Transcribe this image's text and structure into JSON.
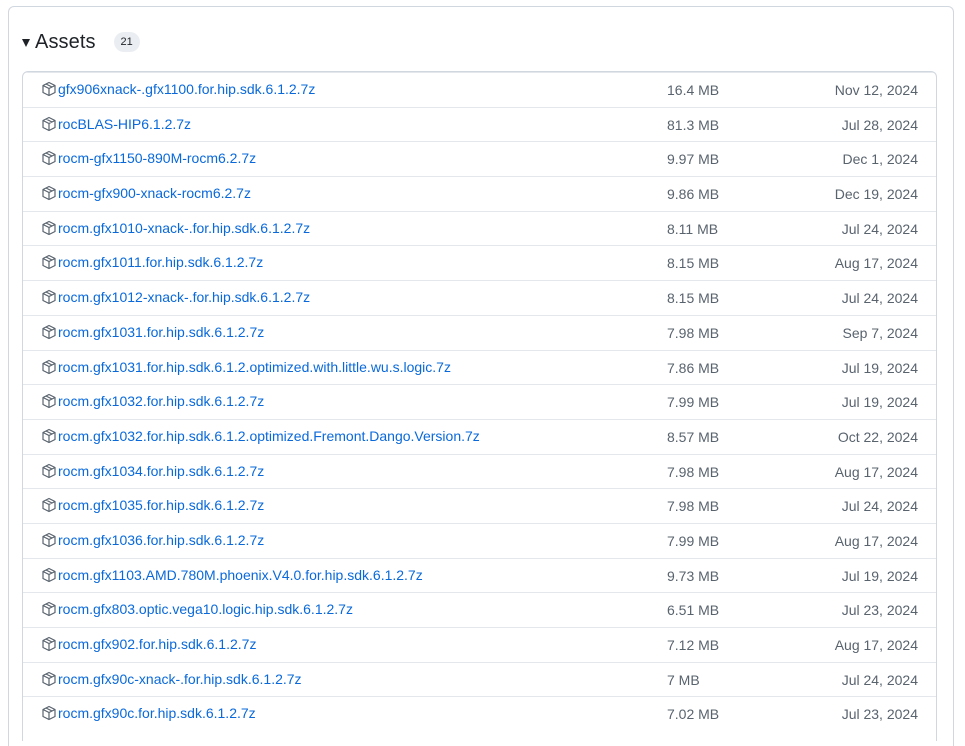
{
  "assets": {
    "title": "Assets",
    "count": "21",
    "items": [
      {
        "name": "gfx906xnack-.gfx1100.for.hip.sdk.6.1.2.7z",
        "size": "16.4 MB",
        "date": "Nov 12, 2024"
      },
      {
        "name": "rocBLAS-HIP6.1.2.7z",
        "size": "81.3 MB",
        "date": "Jul 28, 2024"
      },
      {
        "name": "rocm-gfx1150-890M-rocm6.2.7z",
        "size": "9.97 MB",
        "date": "Dec 1, 2024"
      },
      {
        "name": "rocm-gfx900-xnack-rocm6.2.7z",
        "size": "9.86 MB",
        "date": "Dec 19, 2024"
      },
      {
        "name": "rocm.gfx1010-xnack-.for.hip.sdk.6.1.2.7z",
        "size": "8.11 MB",
        "date": "Jul 24, 2024"
      },
      {
        "name": "rocm.gfx1011.for.hip.sdk.6.1.2.7z",
        "size": "8.15 MB",
        "date": "Aug 17, 2024"
      },
      {
        "name": "rocm.gfx1012-xnack-.for.hip.sdk.6.1.2.7z",
        "size": "8.15 MB",
        "date": "Jul 24, 2024"
      },
      {
        "name": "rocm.gfx1031.for.hip.sdk.6.1.2.7z",
        "size": "7.98 MB",
        "date": "Sep 7, 2024"
      },
      {
        "name": "rocm.gfx1031.for.hip.sdk.6.1.2.optimized.with.little.wu.s.logic.7z",
        "size": "7.86 MB",
        "date": "Jul 19, 2024"
      },
      {
        "name": "rocm.gfx1032.for.hip.sdk.6.1.2.7z",
        "size": "7.99 MB",
        "date": "Jul 19, 2024"
      },
      {
        "name": "rocm.gfx1032.for.hip.sdk.6.1.2.optimized.Fremont.Dango.Version.7z",
        "size": "8.57 MB",
        "date": "Oct 22, 2024"
      },
      {
        "name": "rocm.gfx1034.for.hip.sdk.6.1.2.7z",
        "size": "7.98 MB",
        "date": "Aug 17, 2024"
      },
      {
        "name": "rocm.gfx1035.for.hip.sdk.6.1.2.7z",
        "size": "7.98 MB",
        "date": "Jul 24, 2024"
      },
      {
        "name": "rocm.gfx1036.for.hip.sdk.6.1.2.7z",
        "size": "7.99 MB",
        "date": "Aug 17, 2024"
      },
      {
        "name": "rocm.gfx1103.AMD.780M.phoenix.V4.0.for.hip.sdk.6.1.2.7z",
        "size": "9.73 MB",
        "date": "Jul 19, 2024"
      },
      {
        "name": "rocm.gfx803.optic.vega10.logic.hip.sdk.6.1.2.7z",
        "size": "6.51 MB",
        "date": "Jul 23, 2024"
      },
      {
        "name": "rocm.gfx902.for.hip.sdk.6.1.2.7z",
        "size": "7.12 MB",
        "date": "Aug 17, 2024"
      },
      {
        "name": "rocm.gfx90c-xnack-.for.hip.sdk.6.1.2.7z",
        "size": "7 MB",
        "date": "Jul 24, 2024"
      },
      {
        "name": "rocm.gfx90c.for.hip.sdk.6.1.2.7z",
        "size": "7.02 MB",
        "date": "Jul 23, 2024"
      }
    ]
  },
  "colors": {
    "link": "#0969da",
    "muted": "#59636e",
    "border": "#d0d7de",
    "badge_bg": "#eaeef2"
  },
  "icons": {
    "collapse": "triangle-down-icon",
    "asset": "package-icon"
  }
}
